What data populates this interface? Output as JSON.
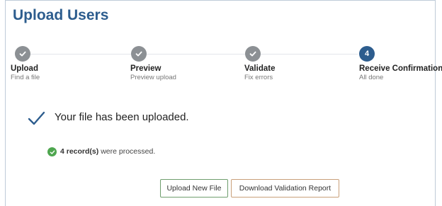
{
  "page": {
    "title": "Upload Users"
  },
  "steps": [
    {
      "name": "Upload",
      "sub": "Find a file",
      "status": "complete",
      "icon": "check-icon"
    },
    {
      "name": "Preview",
      "sub": "Preview upload",
      "status": "complete",
      "icon": "check-icon"
    },
    {
      "name": "Validate",
      "sub": "Fix errors",
      "status": "complete",
      "icon": "check-icon"
    },
    {
      "name": "Receive Confirmation",
      "sub": "All done",
      "status": "current",
      "number": "4"
    }
  ],
  "message": {
    "text": "Your file has been uploaded.",
    "icon": "checkmark-icon"
  },
  "records": {
    "count": "4 record(s)",
    "suffix": " were processed.",
    "icon": "check-circle-icon"
  },
  "buttons": {
    "upload_new": "Upload New File",
    "download_report": "Download Validation Report"
  },
  "colors": {
    "title": "#2d5d8e",
    "step_done": "#8c9094",
    "step_current": "#2d5d8e",
    "success": "#4ea64f",
    "upload_border": "#6f9e6e",
    "download_border": "#c9a07a"
  }
}
